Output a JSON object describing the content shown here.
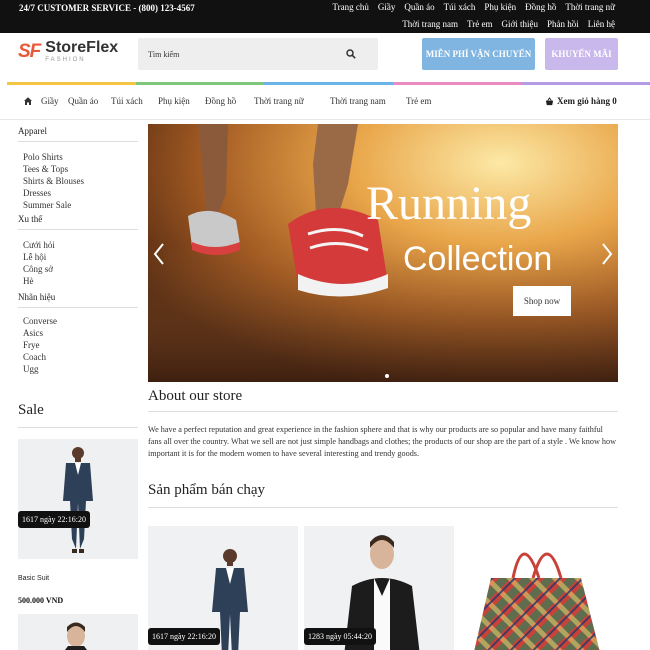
{
  "topbar": {
    "service": "24/7 CUSTOMER SERVICE - (800) 123-4567",
    "row1": [
      "Trang chủ",
      "Giầy",
      "Quần áo",
      "Túi xách",
      "Phụ kiện",
      "Đồng hồ",
      "Thời trang nữ"
    ],
    "row2": [
      "Thời trang nam",
      "Trẻ em",
      "Giới thiệu",
      "Phản hồi",
      "Liên hệ"
    ]
  },
  "header": {
    "logo_mark": "SF",
    "logo_name": "StoreFlex",
    "logo_sub": "FASHION",
    "search_placeholder": "Tìm kiếm",
    "shipping_button": "MIỄN PHÍ VẬN CHUYỂN",
    "promo_button": "KHUYẾN MÃI"
  },
  "rainbow_colors": [
    "#f4c542",
    "#7ec77b",
    "#6bb4e8",
    "#e98ac0",
    "#b59be6"
  ],
  "nav": {
    "items": [
      "Giầy",
      "Quần áo",
      "Túi xách",
      "Phụ kiện",
      "Đồng hồ",
      "Thời trang nữ",
      "Thời trang nam",
      "Trẻ em"
    ],
    "cart": "Xem giỏ hàng 0"
  },
  "sidebar": {
    "groups": [
      {
        "title": "Apparel",
        "items": [
          "Polo Shirts",
          "Tees & Tops",
          "Shirts & Blouses",
          "Dresses",
          "Summer Sale"
        ]
      },
      {
        "title": "Xu thế",
        "items": [
          "Cưới hỏi",
          "Lễ hội",
          "Công sở",
          "Hè"
        ]
      },
      {
        "title": "Nhãn hiệu",
        "items": [
          "Converse",
          "Asics",
          "Frye",
          "Coach",
          "Ugg"
        ]
      }
    ],
    "sale_title": "Sale",
    "sale_timer": "1617 ngày 22:16:20",
    "sale_name": "Basic Suit",
    "sale_price": "500.000 VND"
  },
  "hero": {
    "title1": "Running",
    "title2": "Collection",
    "button": "Shop now"
  },
  "about": {
    "title": "About our store",
    "text": "We have a perfect reputation and great experience in the fashion sphere and that is why our products are so popular and have many faithful fans all over the country. What we sell are not just simple handbags and clothes; the products of our shop are the part of a style . We know how important it is for the modern women to have several interesting and trendy goods."
  },
  "bestsellers": {
    "title": "Sản phẩm bán chạy",
    "products": [
      {
        "timer": "1617 ngày 22:16:20"
      },
      {
        "timer": "1283 ngày 05:44:20"
      },
      {
        "timer": ""
      }
    ]
  }
}
